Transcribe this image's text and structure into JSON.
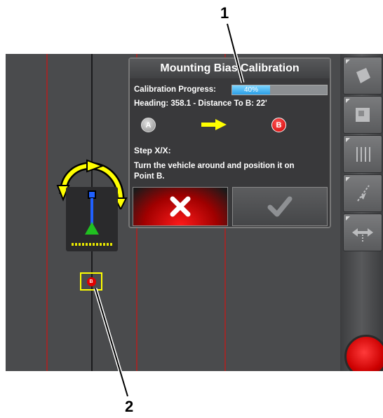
{
  "dialog": {
    "title": "Mounting Bias Calibration",
    "progress_label": "Calibration Progress:",
    "progress_value": 0.4,
    "progress_text": "40%",
    "heading_info": "Heading: 358.1 - Distance To B: 22'",
    "point_a": "A",
    "point_b": "B",
    "step": "Step X/X:",
    "instruction_line1": "Turn the vehicle around and position it on",
    "instruction_line2": "Point B.",
    "cancel_button": "cancel-x-icon",
    "confirm_button": "checkmark-icon"
  },
  "map": {
    "point_b_marker": "B"
  },
  "callouts": {
    "one": "1",
    "two": "2"
  },
  "colors": {
    "accent_yellow": "#ffff00",
    "cancel_red": "#e00000",
    "progress_blue": "#45b4f0"
  }
}
